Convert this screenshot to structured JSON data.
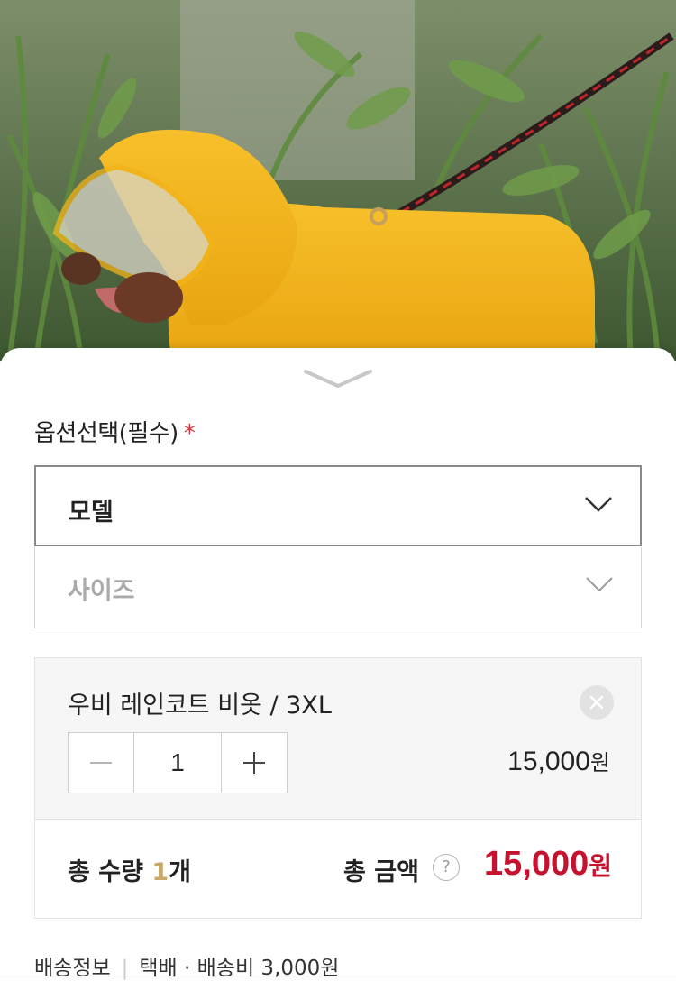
{
  "product_photo": {
    "icon": "dog-in-yellow-raincoat-photo"
  },
  "sheet": {
    "collapse_icon": "chevron-down-icon",
    "options_title": "옵션선택(필수)",
    "required_mark": "*",
    "selects": [
      {
        "label": "모델",
        "state": "active"
      },
      {
        "label": "사이즈",
        "state": "disabled"
      }
    ]
  },
  "selected_item": {
    "name": "우비 레인코트 비옷 / 3XL",
    "quantity": "1",
    "minus_label": "—",
    "plus_label": "+",
    "price": "15,000",
    "price_unit": "원"
  },
  "totals": {
    "qty_prefix": "총 수량 ",
    "qty_value": "1",
    "qty_suffix": "개",
    "amount_label": "총 금액",
    "help_icon": "?",
    "amount": "15,000",
    "amount_unit": "원"
  },
  "shipping": {
    "label": "배송정보",
    "separator": "|",
    "method": "택배 · 배송비 3,000원"
  },
  "colors": {
    "accent_red": "#c4122f",
    "required_star": "#d9333f",
    "qty_highlight": "#c8a96a",
    "raincoat_yellow": "#f4b81c"
  }
}
